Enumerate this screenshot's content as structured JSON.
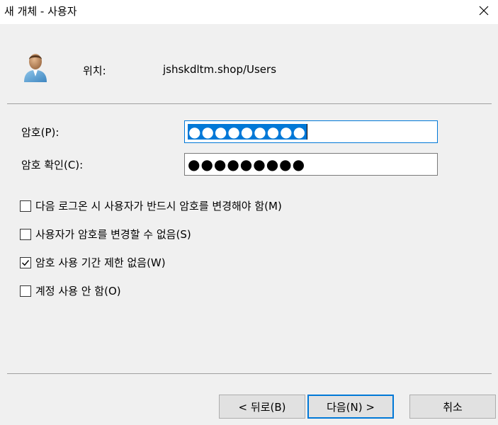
{
  "window": {
    "title": "새 개체 - 사용자"
  },
  "location": {
    "label": "위치:",
    "value": "jshskdltm.shop/Users"
  },
  "password": {
    "label": "암호(P):",
    "masked": "●●●●●●●●●"
  },
  "confirm": {
    "label": "암호 확인(C):",
    "masked": "●●●●●●●●●"
  },
  "options": [
    {
      "label": "다음 로그온 시 사용자가 반드시 암호를 변경해야 함(M)",
      "checked": false
    },
    {
      "label": "사용자가 암호를 변경할 수 없음(S)",
      "checked": false
    },
    {
      "label": "암호 사용 기간 제한 없음(W)",
      "checked": true
    },
    {
      "label": "계정 사용 안 함(O)",
      "checked": false
    }
  ],
  "buttons": {
    "back": "< 뒤로(B)",
    "next": "다음(N) >",
    "cancel": "취소"
  },
  "icons": {
    "close": "close-icon",
    "user": "user-icon",
    "check": "check-icon"
  },
  "colors": {
    "focus": "#0078d7",
    "dialog_bg": "#f0f0f0"
  }
}
